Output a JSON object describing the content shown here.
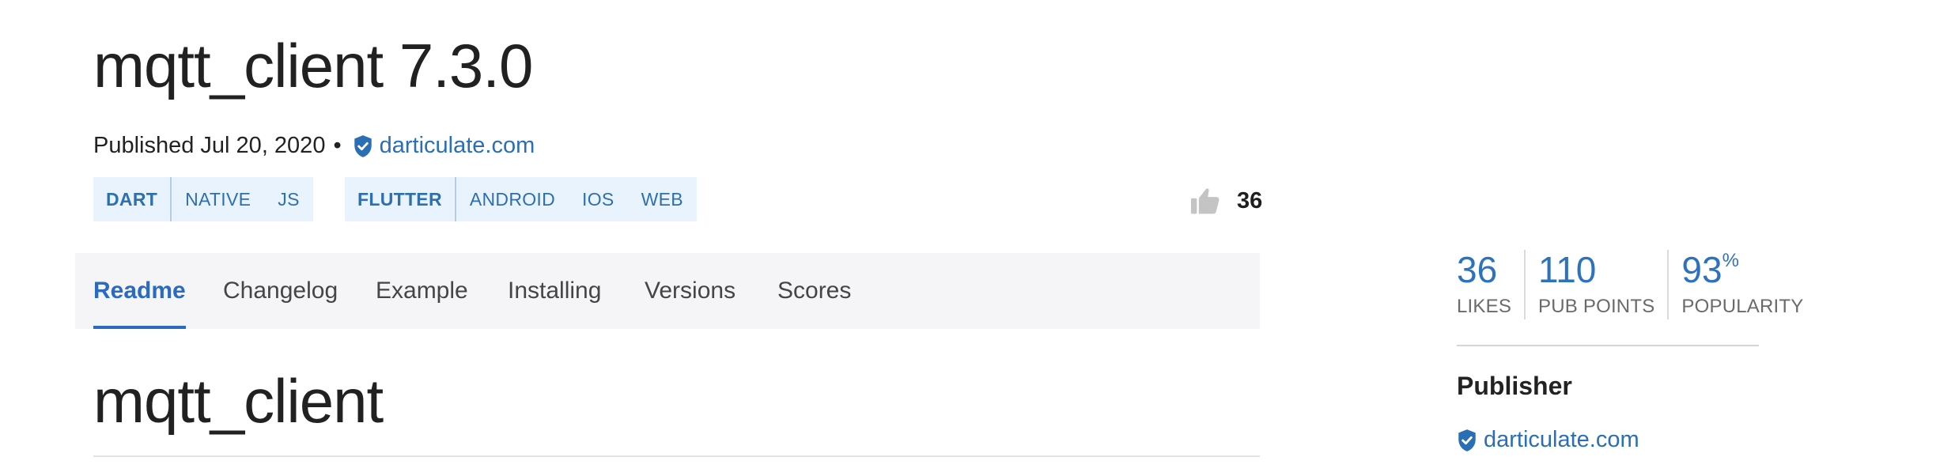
{
  "package": {
    "title": "mqtt_client 7.3.0",
    "published_text": "Published Jul 20, 2020",
    "separator": "•",
    "publisher": "darticulate.com"
  },
  "tags": {
    "group1": {
      "main": "DART",
      "items": [
        "NATIVE",
        "JS"
      ]
    },
    "group2": {
      "main": "FLUTTER",
      "items": [
        "ANDROID",
        "IOS",
        "WEB"
      ]
    }
  },
  "likes_inline": {
    "count": "36",
    "icon": "thumbs-up-icon"
  },
  "tabs": [
    {
      "label": "Readme",
      "active": true
    },
    {
      "label": "Changelog",
      "active": false
    },
    {
      "label": "Example",
      "active": false
    },
    {
      "label": "Installing",
      "active": false
    },
    {
      "label": "Versions",
      "active": false
    },
    {
      "label": "Scores",
      "active": false
    }
  ],
  "readme": {
    "heading": "mqtt_client"
  },
  "stats": [
    {
      "value": "36",
      "suffix": "",
      "label": "LIKES"
    },
    {
      "value": "110",
      "suffix": "",
      "label": "PUB POINTS"
    },
    {
      "value": "93",
      "suffix": "%",
      "label": "POPULARITY"
    }
  ],
  "sidebar": {
    "publisher_heading": "Publisher",
    "publisher_link": "darticulate.com"
  },
  "colors": {
    "accent": "#2a6ac1",
    "link": "#2a6fb3",
    "tag_bg": "#e9f3fd",
    "tabbar_bg": "#f5f5f7"
  }
}
